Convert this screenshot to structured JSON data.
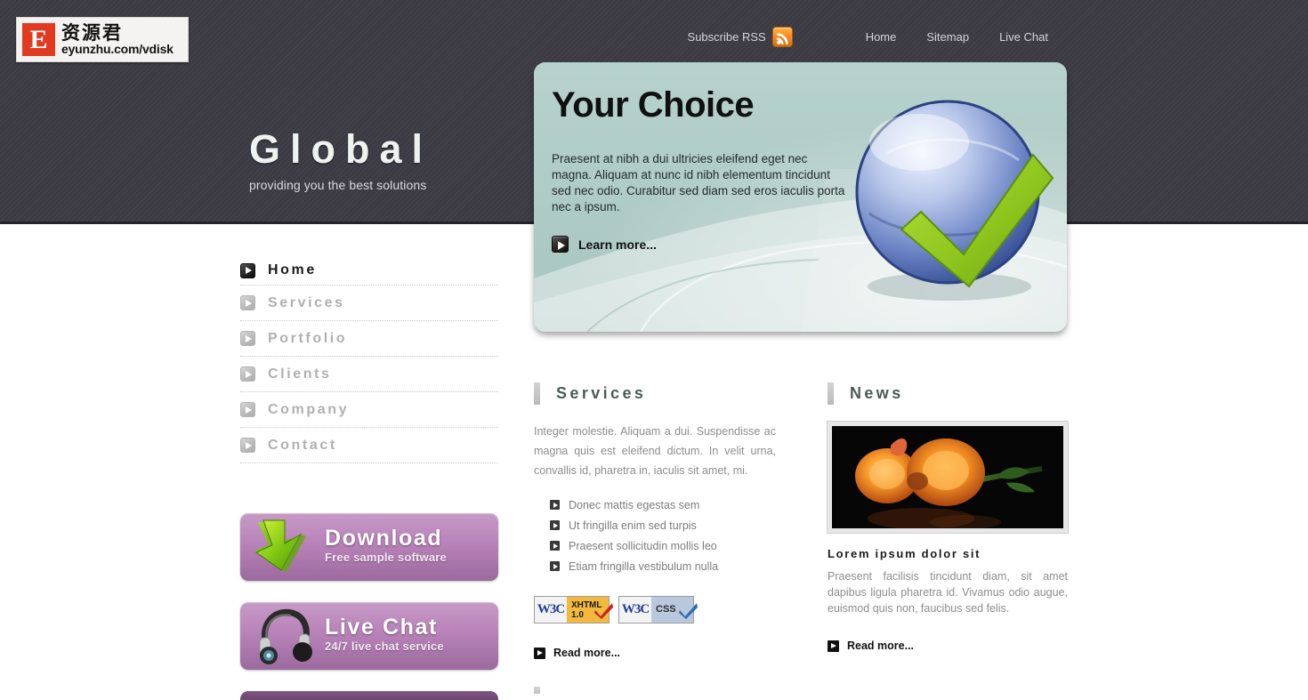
{
  "header": {
    "logo": {
      "mark_letter": "E",
      "cn_name": "资源君",
      "url": "eyunzhu.com/vdisk",
      "mark_color": "#e23a20"
    },
    "topnav": {
      "rss_label": "Subscribe RSS",
      "rss_icon": "rss-icon",
      "links": [
        {
          "label": "Home"
        },
        {
          "label": "Sitemap"
        },
        {
          "label": "Live Chat"
        }
      ]
    },
    "brand": {
      "title": "Global",
      "subtitle": "providing you the best solutions"
    }
  },
  "hero": {
    "heading": "Your Choice",
    "paragraph": "Praesent at nibh a dui ultricies eleifend eget nec magna. Aliquam at nunc id nibh elementum tincidunt sed nec odio. Curabitur sed diam sed eros iaculis porta nec a ipsum.",
    "cta_label": "Learn more...",
    "cta_icon": "arrow-right-icon",
    "art_icon": "blue-globe-with-green-check",
    "panel_color": "#b3cfca"
  },
  "sidebar": {
    "items": [
      {
        "label": "Home",
        "active": true
      },
      {
        "label": "Services",
        "active": false
      },
      {
        "label": "Portfolio",
        "active": false
      },
      {
        "label": "Clients",
        "active": false
      },
      {
        "label": "Company",
        "active": false
      },
      {
        "label": "Contact",
        "active": false
      }
    ],
    "promos": [
      {
        "title": "Download",
        "subtitle": "Free sample software",
        "icon": "green-download-arrow-icon"
      },
      {
        "title": "Live Chat",
        "subtitle": "24/7 live chat service",
        "icon": "headset-icon"
      }
    ],
    "promo_accent": "#b984ba"
  },
  "services": {
    "heading": "Services",
    "paragraph": "Integer molestie. Aliquam a dui. Suspendisse ac magna quis est eleifend dictum. In velit urna, convallis id, pharetra in, iaculis sit amet, mi.",
    "list": [
      {
        "label": "Donec mattis egestas sem"
      },
      {
        "label": "Ut fringilla enim sed turpis"
      },
      {
        "label": "Praesent sollicitudin mollis leo"
      },
      {
        "label": "Etiam fringilla vestibulum nulla"
      }
    ],
    "badges": [
      {
        "org": "W3C",
        "line1": "XHTML",
        "line2": "1.0",
        "tick_color": "#c9231f"
      },
      {
        "org": "W3C",
        "line1": "CSS",
        "line2": "",
        "tick_color": "#2f6fb5"
      }
    ],
    "read_more": "Read more...",
    "read_more_icon": "arrow-right-icon"
  },
  "news": {
    "heading": "News",
    "thumbnail_alt": "orange-chrysanthemum-flowers-photo",
    "item_title": "Lorem ipsum dolor sit",
    "item_paragraph": "Praesent facilisis tincidunt diam, sit amet dapibus ligula pharetra id. Vivamus odio augue, euismod quis non, faucibus sed felis.",
    "read_more": "Read more...",
    "read_more_icon": "arrow-right-icon"
  }
}
